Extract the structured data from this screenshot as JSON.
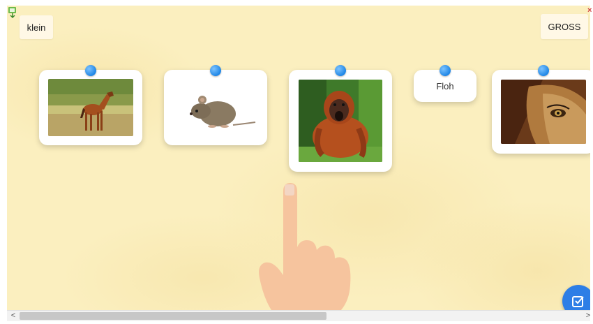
{
  "labels": {
    "small": "klein",
    "big": "GROSS"
  },
  "cards": [
    {
      "id": "horse",
      "type": "image",
      "icon": "horse-photo"
    },
    {
      "id": "mouse",
      "type": "image",
      "icon": "mouse-photo"
    },
    {
      "id": "orangutan",
      "type": "image",
      "icon": "orangutan-photo"
    },
    {
      "id": "flea",
      "type": "text",
      "text": "Floh"
    },
    {
      "id": "lion",
      "type": "image",
      "icon": "lion-photo"
    }
  ],
  "scrollbar": {
    "left_arrow": "<",
    "right_arrow": ">"
  },
  "colors": {
    "background": "#fbefbf",
    "pin": "#1f86e6",
    "check_button": "#2d7ee6"
  },
  "icons": {
    "check_button": "check-square-icon",
    "hand": "pointing-hand-icon",
    "app": "app-corner-icon"
  }
}
